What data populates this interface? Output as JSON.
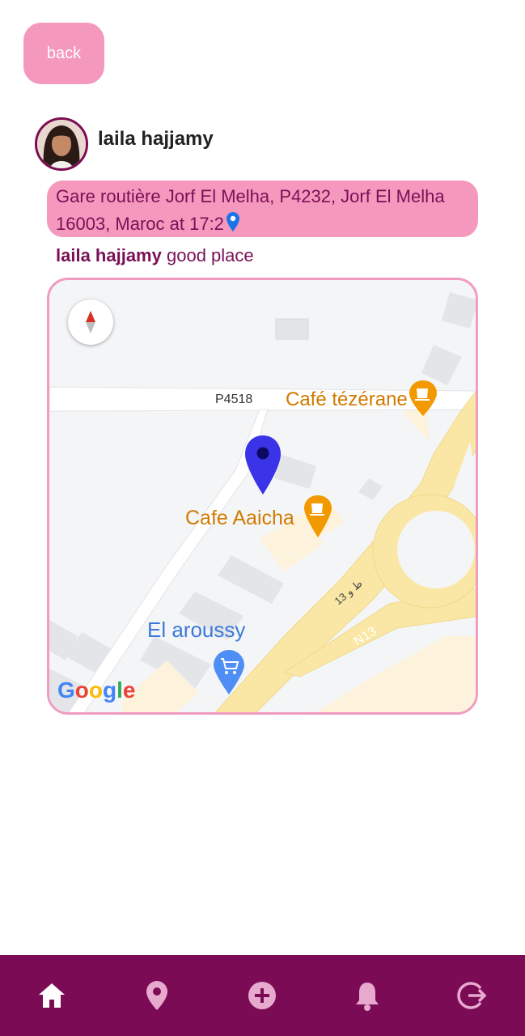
{
  "header": {
    "back_label": "back"
  },
  "post": {
    "username": "laila hajjamy",
    "address": "Gare routière Jorf El Melha, P4232, Jorf El Melha 16003, Maroc at 17:2",
    "comment_author": "laila hajjamy",
    "comment_text": "good place"
  },
  "map": {
    "road_label_1": "P4518",
    "road_label_2": "N13",
    "road_label_3": "13 ط و",
    "place_1": "Café tézérane",
    "place_2": "Cafe Aaicha",
    "place_3": "El aroussy",
    "attribution": "Google",
    "pin_color": "#3a33e8",
    "cafe_icon_color": "#f29900",
    "shop_icon_color": "#4f8ff5"
  },
  "nav": {
    "items": [
      "home-icon",
      "location-icon",
      "add-icon",
      "bell-icon",
      "logout-icon"
    ],
    "active_color": "#ffffff",
    "inactive_color": "#e8a9cf",
    "background": "#7c0b55"
  },
  "colors": {
    "accent_pink": "#f598bd",
    "text_purple": "#7a1057"
  }
}
